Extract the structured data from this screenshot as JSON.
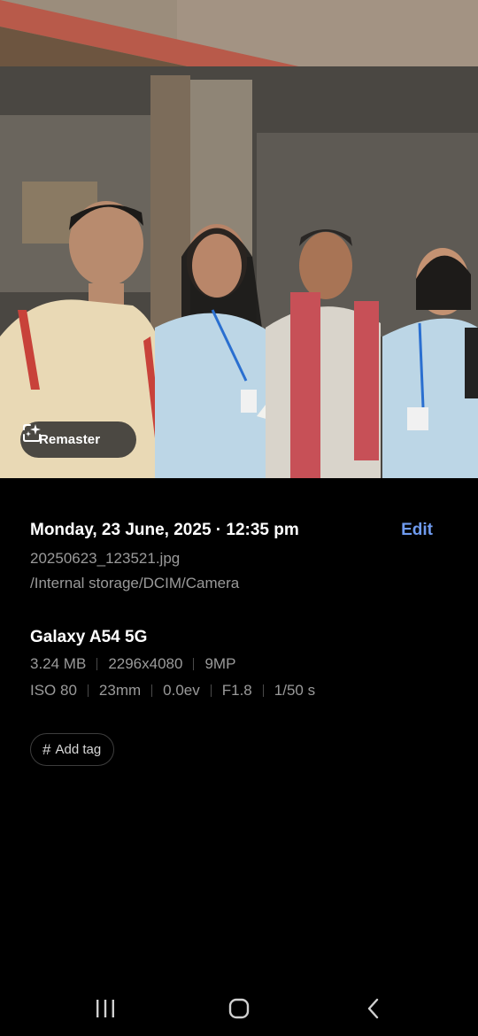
{
  "photo": {
    "remaster_label": "Remaster",
    "remaster_icon": "sparkle-frame-icon"
  },
  "details": {
    "datetime": "Monday, 23 June, 2025 · 12:35 pm",
    "edit_label": "Edit",
    "filename": "20250623_123521.jpg",
    "path": "/Internal storage/DCIM/Camera",
    "device": "Galaxy A54 5G",
    "size": "3.24 MB",
    "resolution": "2296x4080",
    "megapixels": "9MP",
    "iso": "ISO 80",
    "focal_length": "23mm",
    "exposure": "0.0ev",
    "aperture": "F1.8",
    "shutter": "1/50 s",
    "add_tag_label": "Add tag",
    "add_tag_icon": "hash-icon"
  },
  "navbar": {
    "icons": [
      "recent-apps-icon",
      "home-icon",
      "back-icon"
    ]
  },
  "colors": {
    "background": "#000000",
    "accent": "#6f9bf0",
    "secondary_text": "#9a9a9a"
  }
}
